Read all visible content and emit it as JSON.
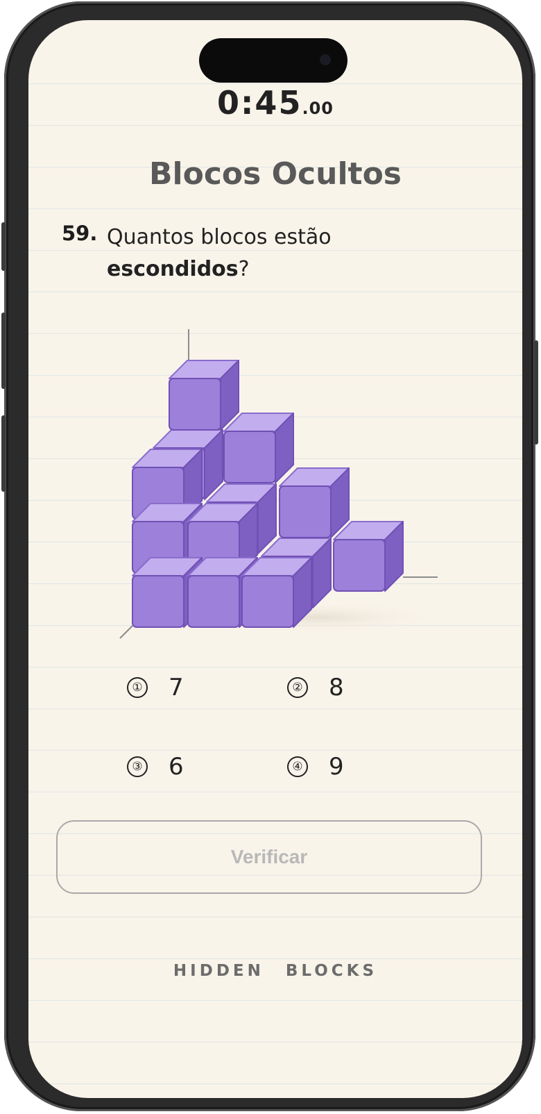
{
  "timer": {
    "main": "0:45",
    "fraction": ".00"
  },
  "title": "Blocos Ocultos",
  "question": {
    "number": "59.",
    "text_plain": "Quantos blocos estão",
    "text_bold": "escondidos",
    "text_end": "?"
  },
  "options": [
    {
      "icon": "①",
      "value": "7"
    },
    {
      "icon": "②",
      "value": "8"
    },
    {
      "icon": "③",
      "value": "6"
    },
    {
      "icon": "④",
      "value": "9"
    }
  ],
  "verify_label": "Verificar",
  "footer": "HIDDEN BLOCKS",
  "colors": {
    "cube_front": "#9d80da",
    "cube_top": "#c2adef",
    "cube_side": "#7e60c2",
    "background": "#f9f4ea"
  }
}
